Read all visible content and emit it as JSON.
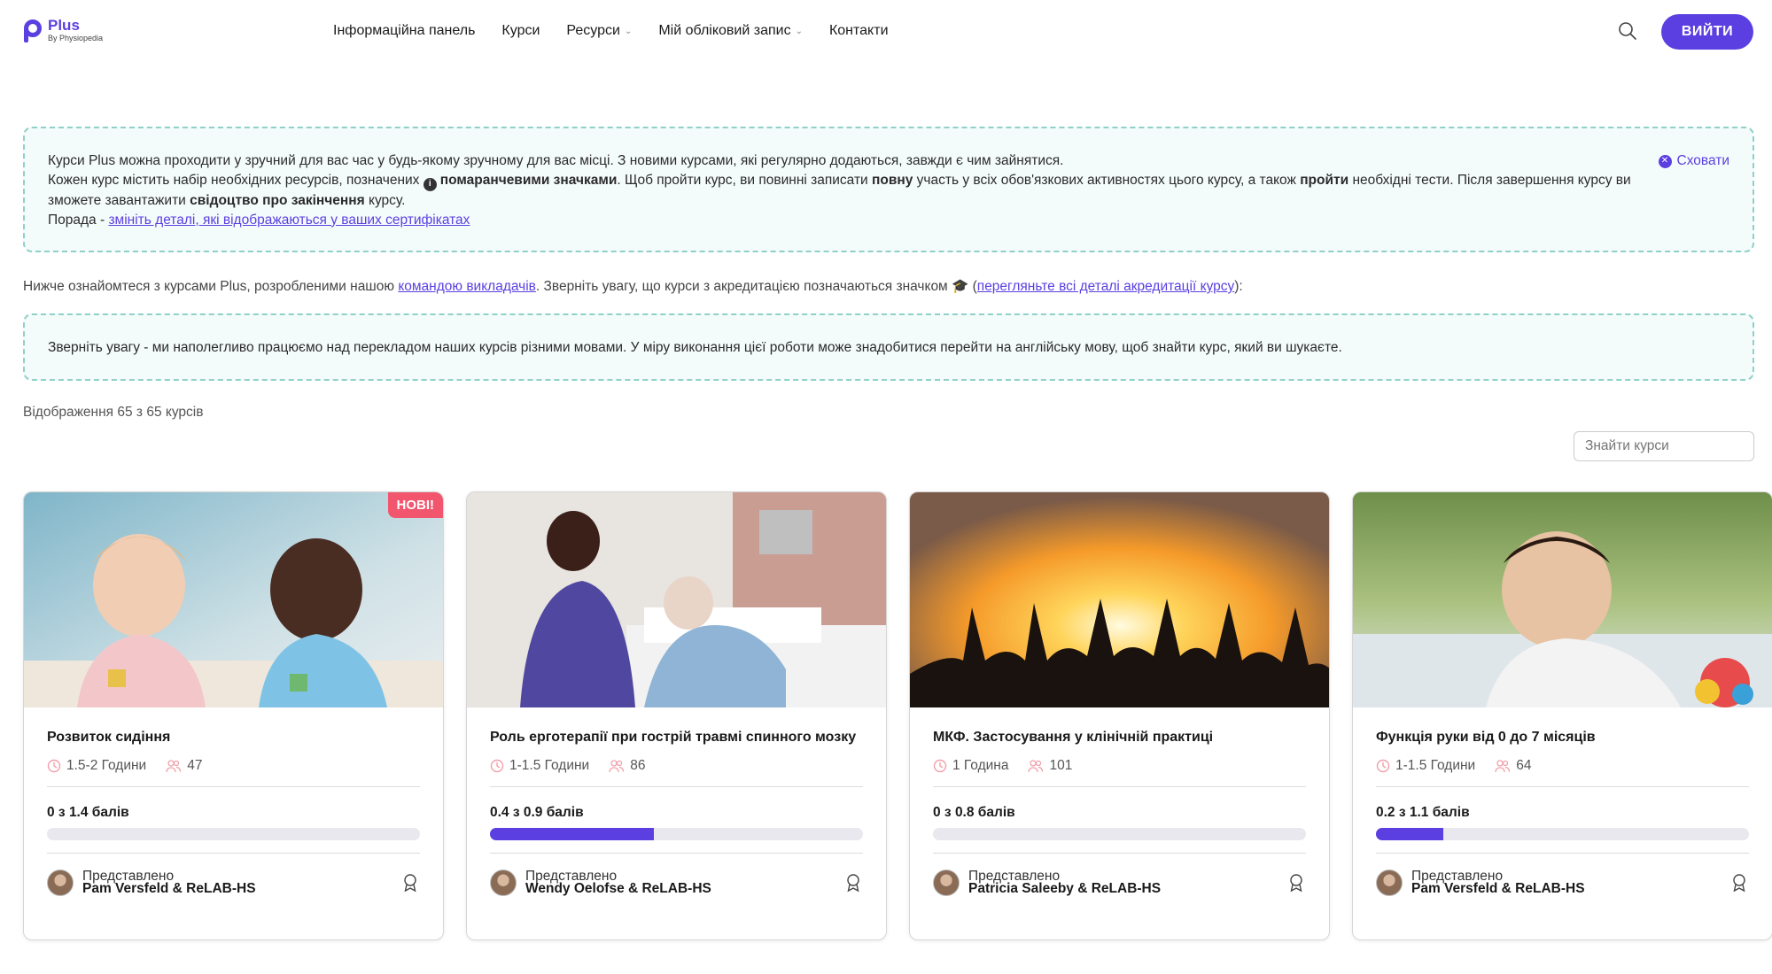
{
  "brand": {
    "name": "Plus",
    "tagline": "By Physiopedia",
    "accent": "#5b3fe0"
  },
  "nav": {
    "items": [
      {
        "label": "Інформаційна панель",
        "dropdown": false
      },
      {
        "label": "Курси",
        "dropdown": false
      },
      {
        "label": "Ресурси",
        "dropdown": true
      },
      {
        "label": "Мій обліковий запис",
        "dropdown": true
      },
      {
        "label": "Контакти",
        "dropdown": false
      }
    ],
    "logout_label": "ВИЙТИ"
  },
  "info": {
    "hide_label": "Сховати",
    "line1": "Курси Plus можна проходити у зручний для вас час у будь-якому зручному для вас місці. З новими курсами, які регулярно додаються, завжди є чим зайнятися.",
    "line2_a": "Кожен курс містить набір необхідних ресурсів, позначених",
    "line2_b": "помаранчевими значками",
    "line2_c": ". Щоб пройти курс, ви повинні записати",
    "line2_d": "повну",
    "line2_e": "участь у всіх обов'язкових активностях цього курсу, а також",
    "line2_f": "пройти",
    "line2_g": "необхідні тести. Після завершення курсу ви зможете завантажити",
    "line2_h": "свідоцтво про закінчення",
    "line2_i": "курсу.",
    "tip_prefix": "Порада -",
    "tip_link": "змініть деталі, які відображаються у ваших сертифікатах"
  },
  "note": {
    "a": "Нижче ознайомтеся з курсами Plus, розробленими нашою",
    "link1": "командою викладачів",
    "b": ". Зверніть увагу, що курси з акредитацією позначаються значком 🎓 (",
    "link2": "перегляньте всі деталі акредитації курсу",
    "c": "):"
  },
  "translation_note": "Зверніть увагу - ми наполегливо працюємо над перекладом наших курсів різними мовами. У міру виконання цієї роботи може знадобитися перейти на англійську мову, щоб знайти курс, який ви шукаєте.",
  "count_text": "Відображення 65 з 65 курсів",
  "search": {
    "placeholder": "Знайти курси"
  },
  "presented_label": "Представлено",
  "courses": [
    {
      "title": "Розвиток сидіння",
      "badge": "НОВІ!",
      "duration": "1.5-2 Години",
      "enrolled": "47",
      "points": "0 з 1.4 балів",
      "progress": 0.0,
      "presenter": "Pam Versfeld & ReLAB-HS"
    },
    {
      "title": "Роль ерготерапії при гострій травмі спинного мозку",
      "badge": "",
      "duration": "1-1.5 Години",
      "enrolled": "86",
      "points": "0.4 з 0.9 балів",
      "progress": 0.44,
      "presenter": "Wendy Oelofse & ReLAB-HS"
    },
    {
      "title": "МКФ. Застосування у клінічній практиці",
      "badge": "",
      "duration": "1 Година",
      "enrolled": "101",
      "points": "0 з 0.8 балів",
      "progress": 0.0,
      "presenter": "Patricia Saleeby & ReLAB-HS"
    },
    {
      "title": "Функція руки від 0 до 7 місяців",
      "badge": "",
      "duration": "1-1.5 Години",
      "enrolled": "64",
      "points": "0.2 з 1.1 балів",
      "progress": 0.18,
      "presenter": "Pam Versfeld & ReLAB-HS"
    }
  ]
}
